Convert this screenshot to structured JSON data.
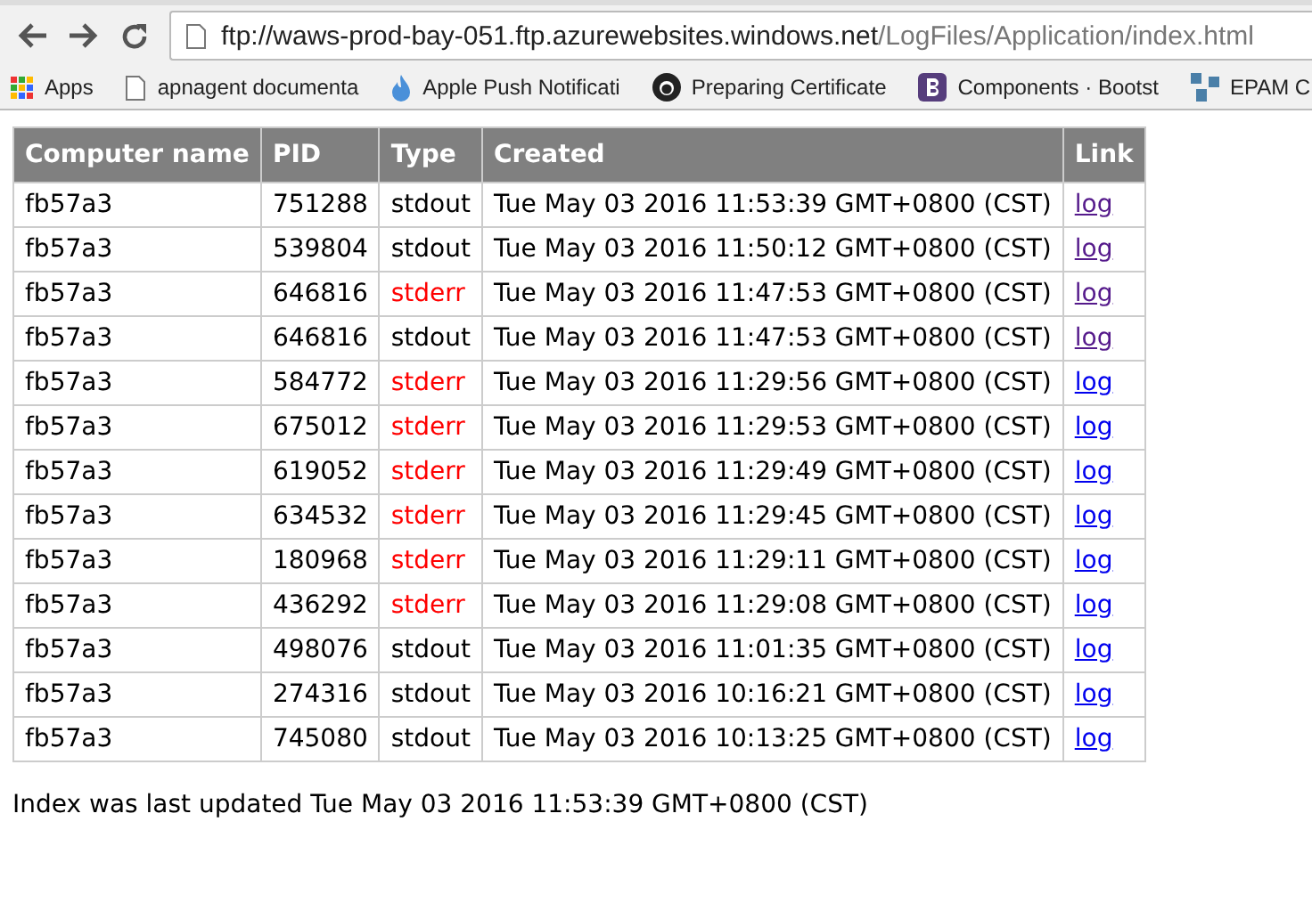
{
  "browser": {
    "url_host": "ftp://waws-prod-bay-051.ftp.azurewebsites.windows.net",
    "url_path": "/LogFiles/Application/index.html",
    "bookmarks": [
      {
        "label": "Apps",
        "kind": "apps"
      },
      {
        "label": "apnagent documenta",
        "kind": "page"
      },
      {
        "label": "Apple Push Notificati",
        "kind": "flame"
      },
      {
        "label": "Preparing Certificate",
        "kind": "github"
      },
      {
        "label": "Components · Bootst",
        "kind": "bootstrap"
      },
      {
        "label": "EPAM C",
        "kind": "epam"
      }
    ]
  },
  "table": {
    "columns": [
      "Computer name",
      "PID",
      "Type",
      "Created",
      "Link"
    ],
    "rows": [
      {
        "computer": "fb57a3",
        "pid": "751288",
        "type": "stdout",
        "kind": "stdout",
        "created": "Tue May 03 2016 11:53:39 GMT+0800 (CST)",
        "link": "log",
        "visited": true
      },
      {
        "computer": "fb57a3",
        "pid": "539804",
        "type": "stdout",
        "kind": "stdout",
        "created": "Tue May 03 2016 11:50:12 GMT+0800 (CST)",
        "link": "log",
        "visited": true
      },
      {
        "computer": "fb57a3",
        "pid": "646816",
        "type": "stderr",
        "kind": "stderr",
        "created": "Tue May 03 2016 11:47:53 GMT+0800 (CST)",
        "link": "log",
        "visited": true
      },
      {
        "computer": "fb57a3",
        "pid": "646816",
        "type": "stdout",
        "kind": "stdout",
        "created": "Tue May 03 2016 11:47:53 GMT+0800 (CST)",
        "link": "log",
        "visited": true
      },
      {
        "computer": "fb57a3",
        "pid": "584772",
        "type": "stderr",
        "kind": "stderr",
        "created": "Tue May 03 2016 11:29:56 GMT+0800 (CST)",
        "link": "log",
        "visited": false
      },
      {
        "computer": "fb57a3",
        "pid": "675012",
        "type": "stderr",
        "kind": "stderr",
        "created": "Tue May 03 2016 11:29:53 GMT+0800 (CST)",
        "link": "log",
        "visited": false
      },
      {
        "computer": "fb57a3",
        "pid": "619052",
        "type": "stderr",
        "kind": "stderr",
        "created": "Tue May 03 2016 11:29:49 GMT+0800 (CST)",
        "link": "log",
        "visited": false
      },
      {
        "computer": "fb57a3",
        "pid": "634532",
        "type": "stderr",
        "kind": "stderr",
        "created": "Tue May 03 2016 11:29:45 GMT+0800 (CST)",
        "link": "log",
        "visited": false
      },
      {
        "computer": "fb57a3",
        "pid": "180968",
        "type": "stderr",
        "kind": "stderr",
        "created": "Tue May 03 2016 11:29:11 GMT+0800 (CST)",
        "link": "log",
        "visited": false
      },
      {
        "computer": "fb57a3",
        "pid": "436292",
        "type": "stderr",
        "kind": "stderr",
        "created": "Tue May 03 2016 11:29:08 GMT+0800 (CST)",
        "link": "log",
        "visited": false
      },
      {
        "computer": "fb57a3",
        "pid": "498076",
        "type": "stdout",
        "kind": "stdout",
        "created": "Tue May 03 2016 11:01:35 GMT+0800 (CST)",
        "link": "log",
        "visited": false
      },
      {
        "computer": "fb57a3",
        "pid": "274316",
        "type": "stdout",
        "kind": "stdout",
        "created": "Tue May 03 2016 10:16:21 GMT+0800 (CST)",
        "link": "log",
        "visited": false
      },
      {
        "computer": "fb57a3",
        "pid": "745080",
        "type": "stdout",
        "kind": "stdout",
        "created": "Tue May 03 2016 10:13:25 GMT+0800 (CST)",
        "link": "log",
        "visited": false
      }
    ]
  },
  "footer": "Index was last updated Tue May 03 2016 11:53:39 GMT+0800 (CST)"
}
